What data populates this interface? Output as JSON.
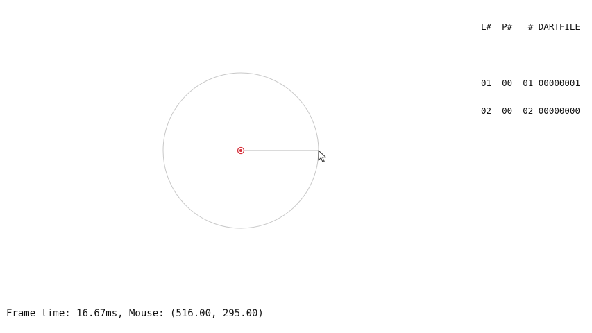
{
  "layer_table": {
    "header": "L#  P#   # DARTFILE",
    "rows": [
      "01  00  01 00000001",
      "02  00  02 00000000"
    ]
  },
  "status": {
    "text": "Frame time: 16.67ms, Mouse: (516.00, 295.00)"
  },
  "colors": {
    "circle_stroke": "#c8c8c8",
    "radius_line": "#b4b4b4",
    "center_marker": "#d62f3a",
    "background": "#ffffff"
  },
  "cursor": {
    "icon": "arrow-pointer-icon"
  }
}
